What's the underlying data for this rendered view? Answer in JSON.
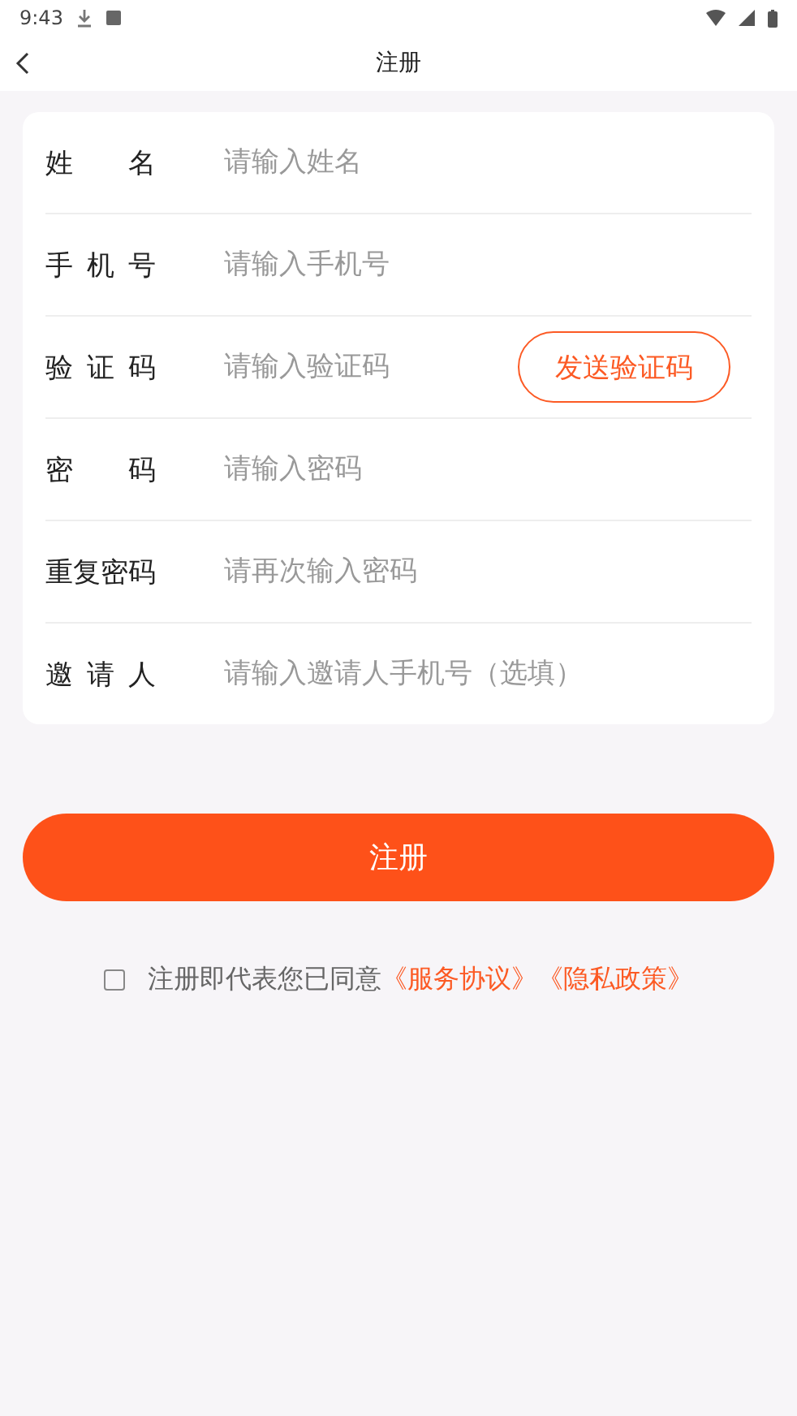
{
  "status_bar": {
    "time": "9:43"
  },
  "header": {
    "title": "注册"
  },
  "fields": [
    {
      "kind": "text",
      "label": "姓名",
      "placeholder": "请输入姓名"
    },
    {
      "kind": "text",
      "label": "手机号",
      "placeholder": "请输入手机号"
    },
    {
      "kind": "code",
      "label": "验证码",
      "placeholder": "请输入验证码",
      "button": "发送验证码"
    },
    {
      "kind": "password",
      "label": "密码",
      "placeholder": "请输入密码"
    },
    {
      "kind": "password",
      "label": "重复密码",
      "placeholder": "请再次输入密码"
    },
    {
      "kind": "text",
      "label": "邀请人",
      "placeholder": "请输入邀请人手机号（选填）"
    }
  ],
  "submit": "注册",
  "agreement": {
    "checked": false,
    "text": "注册即代表您已同意",
    "links": [
      "《服务协议》",
      "《隐私政策》"
    ]
  }
}
